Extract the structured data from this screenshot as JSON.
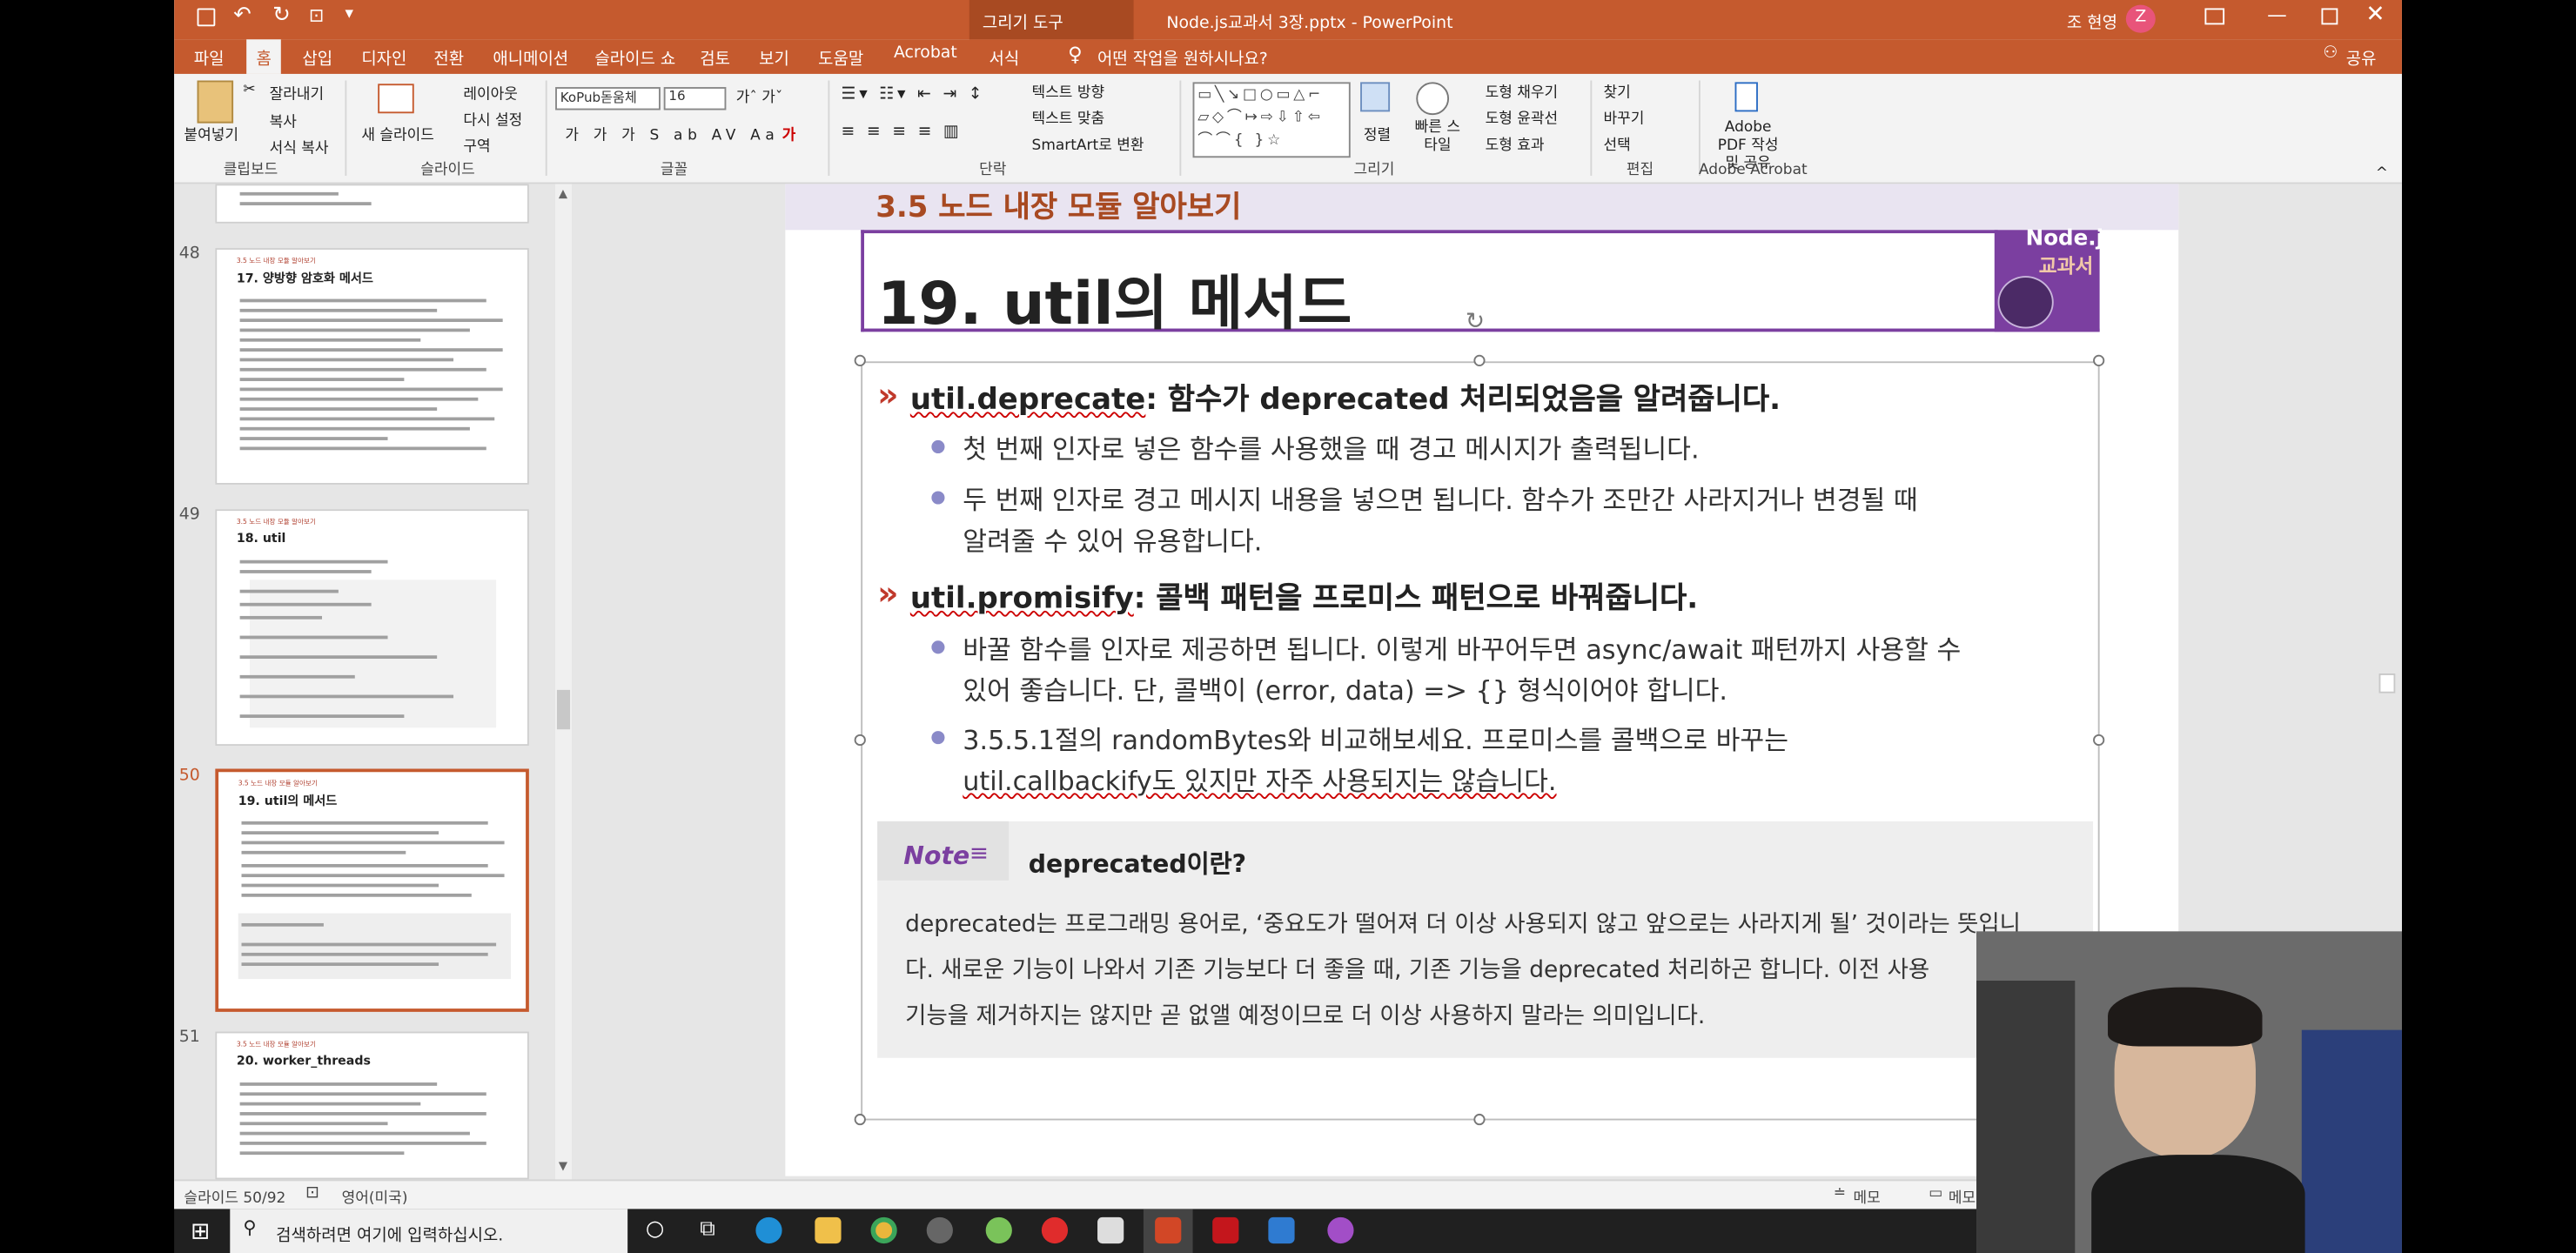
{
  "titlebar": {
    "context_tab": "그리기 도구",
    "doc_title": "Node.js교과서 3장.pptx  -  PowerPoint",
    "user_name": "조 현영",
    "user_initial": "Z"
  },
  "ribbon_tabs": [
    "파일",
    "홈",
    "삽입",
    "디자인",
    "전환",
    "애니메이션",
    "슬라이드 쇼",
    "검토",
    "보기",
    "도움말",
    "Acrobat",
    "서식"
  ],
  "tell_me": "어떤 작업을 원하시나요?",
  "share": "공유",
  "ribbon": {
    "clipboard": {
      "paste": "붙여넣기",
      "cut": "잘라내기",
      "copy": "복사",
      "format_painter": "서식 복사",
      "label": "클립보드"
    },
    "slides": {
      "new_slide": "새 슬라이드",
      "layout": "레이아웃",
      "reset": "다시 설정",
      "section": "구역",
      "label": "슬라이드"
    },
    "font": {
      "family": "KoPub돋움체",
      "size": "16",
      "label": "글꼴"
    },
    "paragraph": {
      "text_direction": "텍스트 방향",
      "align_text": "텍스트 맞춤",
      "smartart": "SmartArt로 변환",
      "label": "단락"
    },
    "drawing": {
      "arrange": "정렬",
      "quick_styles": "빠른 스타일",
      "shape_fill": "도형 채우기",
      "shape_outline": "도형 윤곽선",
      "shape_effects": "도형 효과",
      "label": "그리기"
    },
    "editing": {
      "find": "찾기",
      "replace": "바꾸기",
      "select": "선택",
      "label": "편집"
    },
    "acrobat": {
      "create_pdf": "Adobe PDF 작성 및 공유",
      "label": "Adobe Acrobat"
    }
  },
  "thumbnails": [
    {
      "num": "48",
      "title": "17. 양방향 암호화 메서드"
    },
    {
      "num": "49",
      "title": "18. util"
    },
    {
      "num": "50",
      "title": "19. util의 메서드"
    },
    {
      "num": "51",
      "title": "20. worker_threads"
    }
  ],
  "slide": {
    "section": "3.5 노드 내장 모듈 알아보기",
    "title": "19. util의 메서드",
    "logo_top": "Node.js",
    "logo_bottom": "교과서",
    "h1_code": "util.deprecate",
    "h1_text": ": 함수가 deprecated 처리되었음을 알려줍니다.",
    "b1": "첫 번째 인자로 넣은 함수를 사용했을 때 경고 메시지가 출력됩니다.",
    "b2_l1": "두 번째 인자로 경고 메시지 내용을 넣으면 됩니다. 함수가 조만간 사라지거나 변경될 때",
    "b2_l2": "알려줄 수 있어 유용합니다.",
    "h2_code": "util.promisify",
    "h2_text": ": 콜백 패턴을 프로미스 패턴으로 바꿔줍니다.",
    "b3_l1": "바꿀 함수를 인자로 제공하면 됩니다. 이렇게 바꾸어두면 async/await 패턴까지 사용할 수",
    "b3_l2": "있어 좋습니다. 단, 콜백이 (error, data) => {} 형식이어야 합니다.",
    "b4_l1": "3.5.5.1절의 randomBytes와 비교해보세요. 프로미스를 콜백으로 바꾸는",
    "b4_l2": "util.callbackify도 있지만 자주 사용되지는 않습니다.",
    "note_label": "Note",
    "note_title": "deprecated이란?",
    "note_l1": "deprecated는 프로그래밍 용어로, ‘중요도가 떨어져 더 이상 사용되지 않고 앞으로는 사라지게 될’ 것이라는 뜻입니",
    "note_l2": "다. 새로운 기능이 나와서 기존 기능보다 더 좋을 때, 기존 기능을 deprecated 처리하곤 합니다. 이전 사용",
    "note_l3": "기능을 제거하지는 않지만 곧 없앨 예정이므로 더 이상 사용하지 말라는 의미입니다."
  },
  "status": {
    "slide_count": "슬라이드 50/92",
    "language": "영어(미국)",
    "notes": "메모",
    "comments": "메모"
  },
  "taskbar": {
    "search_placeholder": "검색하려면 여기에 입력하십시오."
  },
  "colors": {
    "accent": "#c55a2e",
    "slide_purple": "#7b3fa0",
    "chevron_red": "#c0392b"
  }
}
